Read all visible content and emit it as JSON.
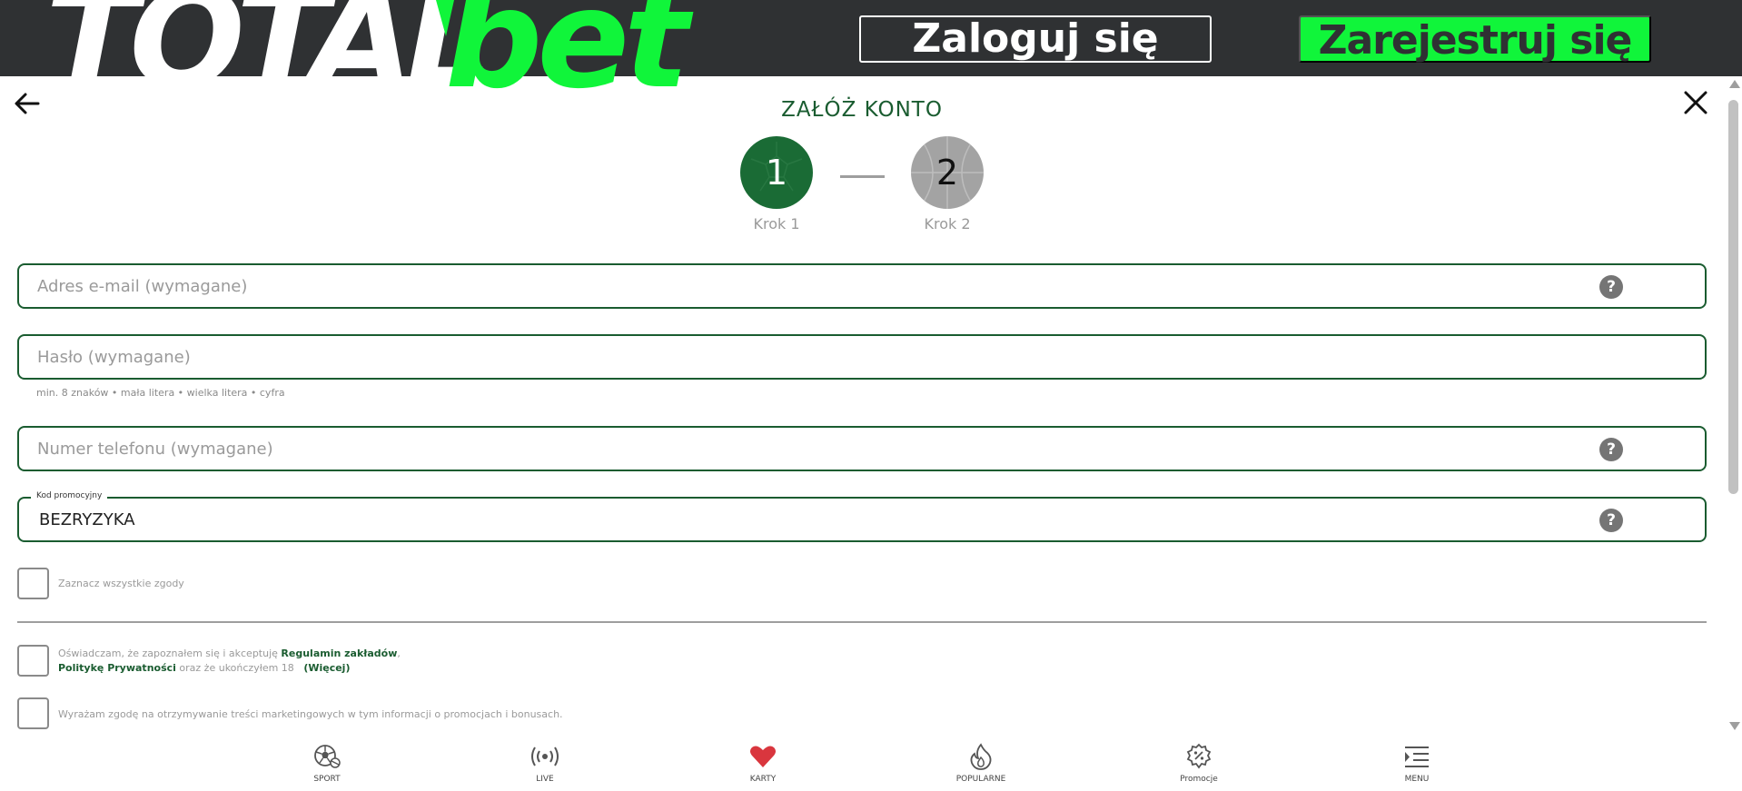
{
  "header": {
    "logo_left": "TOTAL",
    "logo_right": "bet",
    "login_label": "Zaloguj się",
    "register_label": "Zarejestruj się"
  },
  "modal": {
    "title": "ZAŁÓŻ KONTO",
    "steps": [
      {
        "number": "1",
        "label": "Krok 1",
        "active": true
      },
      {
        "number": "2",
        "label": "Krok 2",
        "active": false
      }
    ]
  },
  "form": {
    "email": {
      "placeholder": "Adres e-mail (wymagane)",
      "help_icon": "?"
    },
    "password": {
      "placeholder": "Hasło (wymagane)",
      "hint": "min. 8 znaków • mała litera • wielka litera • cyfra"
    },
    "phone": {
      "placeholder": "Numer telefonu (wymagane)",
      "help_icon": "?"
    },
    "promo": {
      "legend": "Kod promocyjny",
      "value": "BEZRYZYKA",
      "help_icon": "?"
    }
  },
  "consents": {
    "select_all": "Zaznacz wszystkie zgody",
    "terms": {
      "prefix": "Oświadczam, że zapoznałem się i akceptuję ",
      "link1": "Regulamin zakładów",
      "sep": ",",
      "link2": "Politykę Prywatności",
      "suffix": " oraz że ukończyłem 18",
      "more": "(Więcej)"
    },
    "marketing": "Wyrażam zgodę na otrzymywanie treści marketingowych w tym informacji o promocjach i bonusach."
  },
  "bottom_nav": [
    {
      "label": "SPORT",
      "icon": "soccer-ball-icon"
    },
    {
      "label": "LIVE",
      "icon": "broadcast-icon"
    },
    {
      "label": "KARTY",
      "icon": "heart-card-icon"
    },
    {
      "label": "POPULARNE",
      "icon": "flame-icon"
    },
    {
      "label": "Promocje",
      "icon": "percent-badge-icon"
    },
    {
      "label": "MENU",
      "icon": "menu-icon"
    }
  ],
  "colors": {
    "header_bg": "#2f3133",
    "brand_green": "#10f53a",
    "dark_green": "#1a5c30",
    "step_active": "#1a6b35",
    "step_inactive": "#a3a3a3",
    "heart": "#d9363e"
  }
}
